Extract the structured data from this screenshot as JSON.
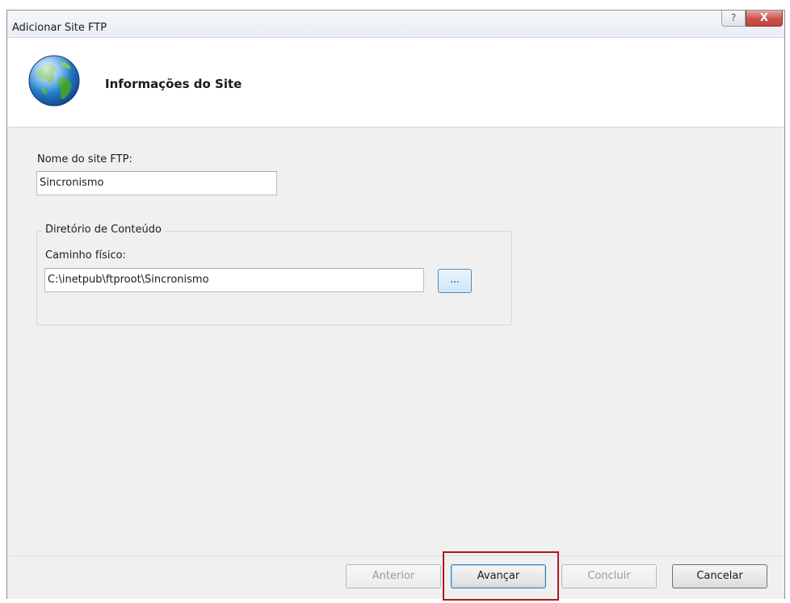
{
  "window": {
    "title": "Adicionar Site FTP",
    "help_label": "?",
    "close_label": "X"
  },
  "header": {
    "title": "Informações do Site",
    "icon": "globe-icon"
  },
  "form": {
    "site_name_label": "Nome do site FTP:",
    "site_name_value": "Sincronismo",
    "content_dir_group_label": "Diretório de Conteúdo",
    "physical_path_label": "Caminho físico:",
    "physical_path_value": "C:\\inetpub\\ftproot\\Sincronismo",
    "browse_label": "..."
  },
  "footer": {
    "previous_label": "Anterior",
    "next_label": "Avançar",
    "finish_label": "Concluir",
    "cancel_label": "Cancelar"
  },
  "colors": {
    "highlight_box": "#b5141c",
    "close_button": "#c9524a",
    "content_background": "#f0f0f0"
  }
}
